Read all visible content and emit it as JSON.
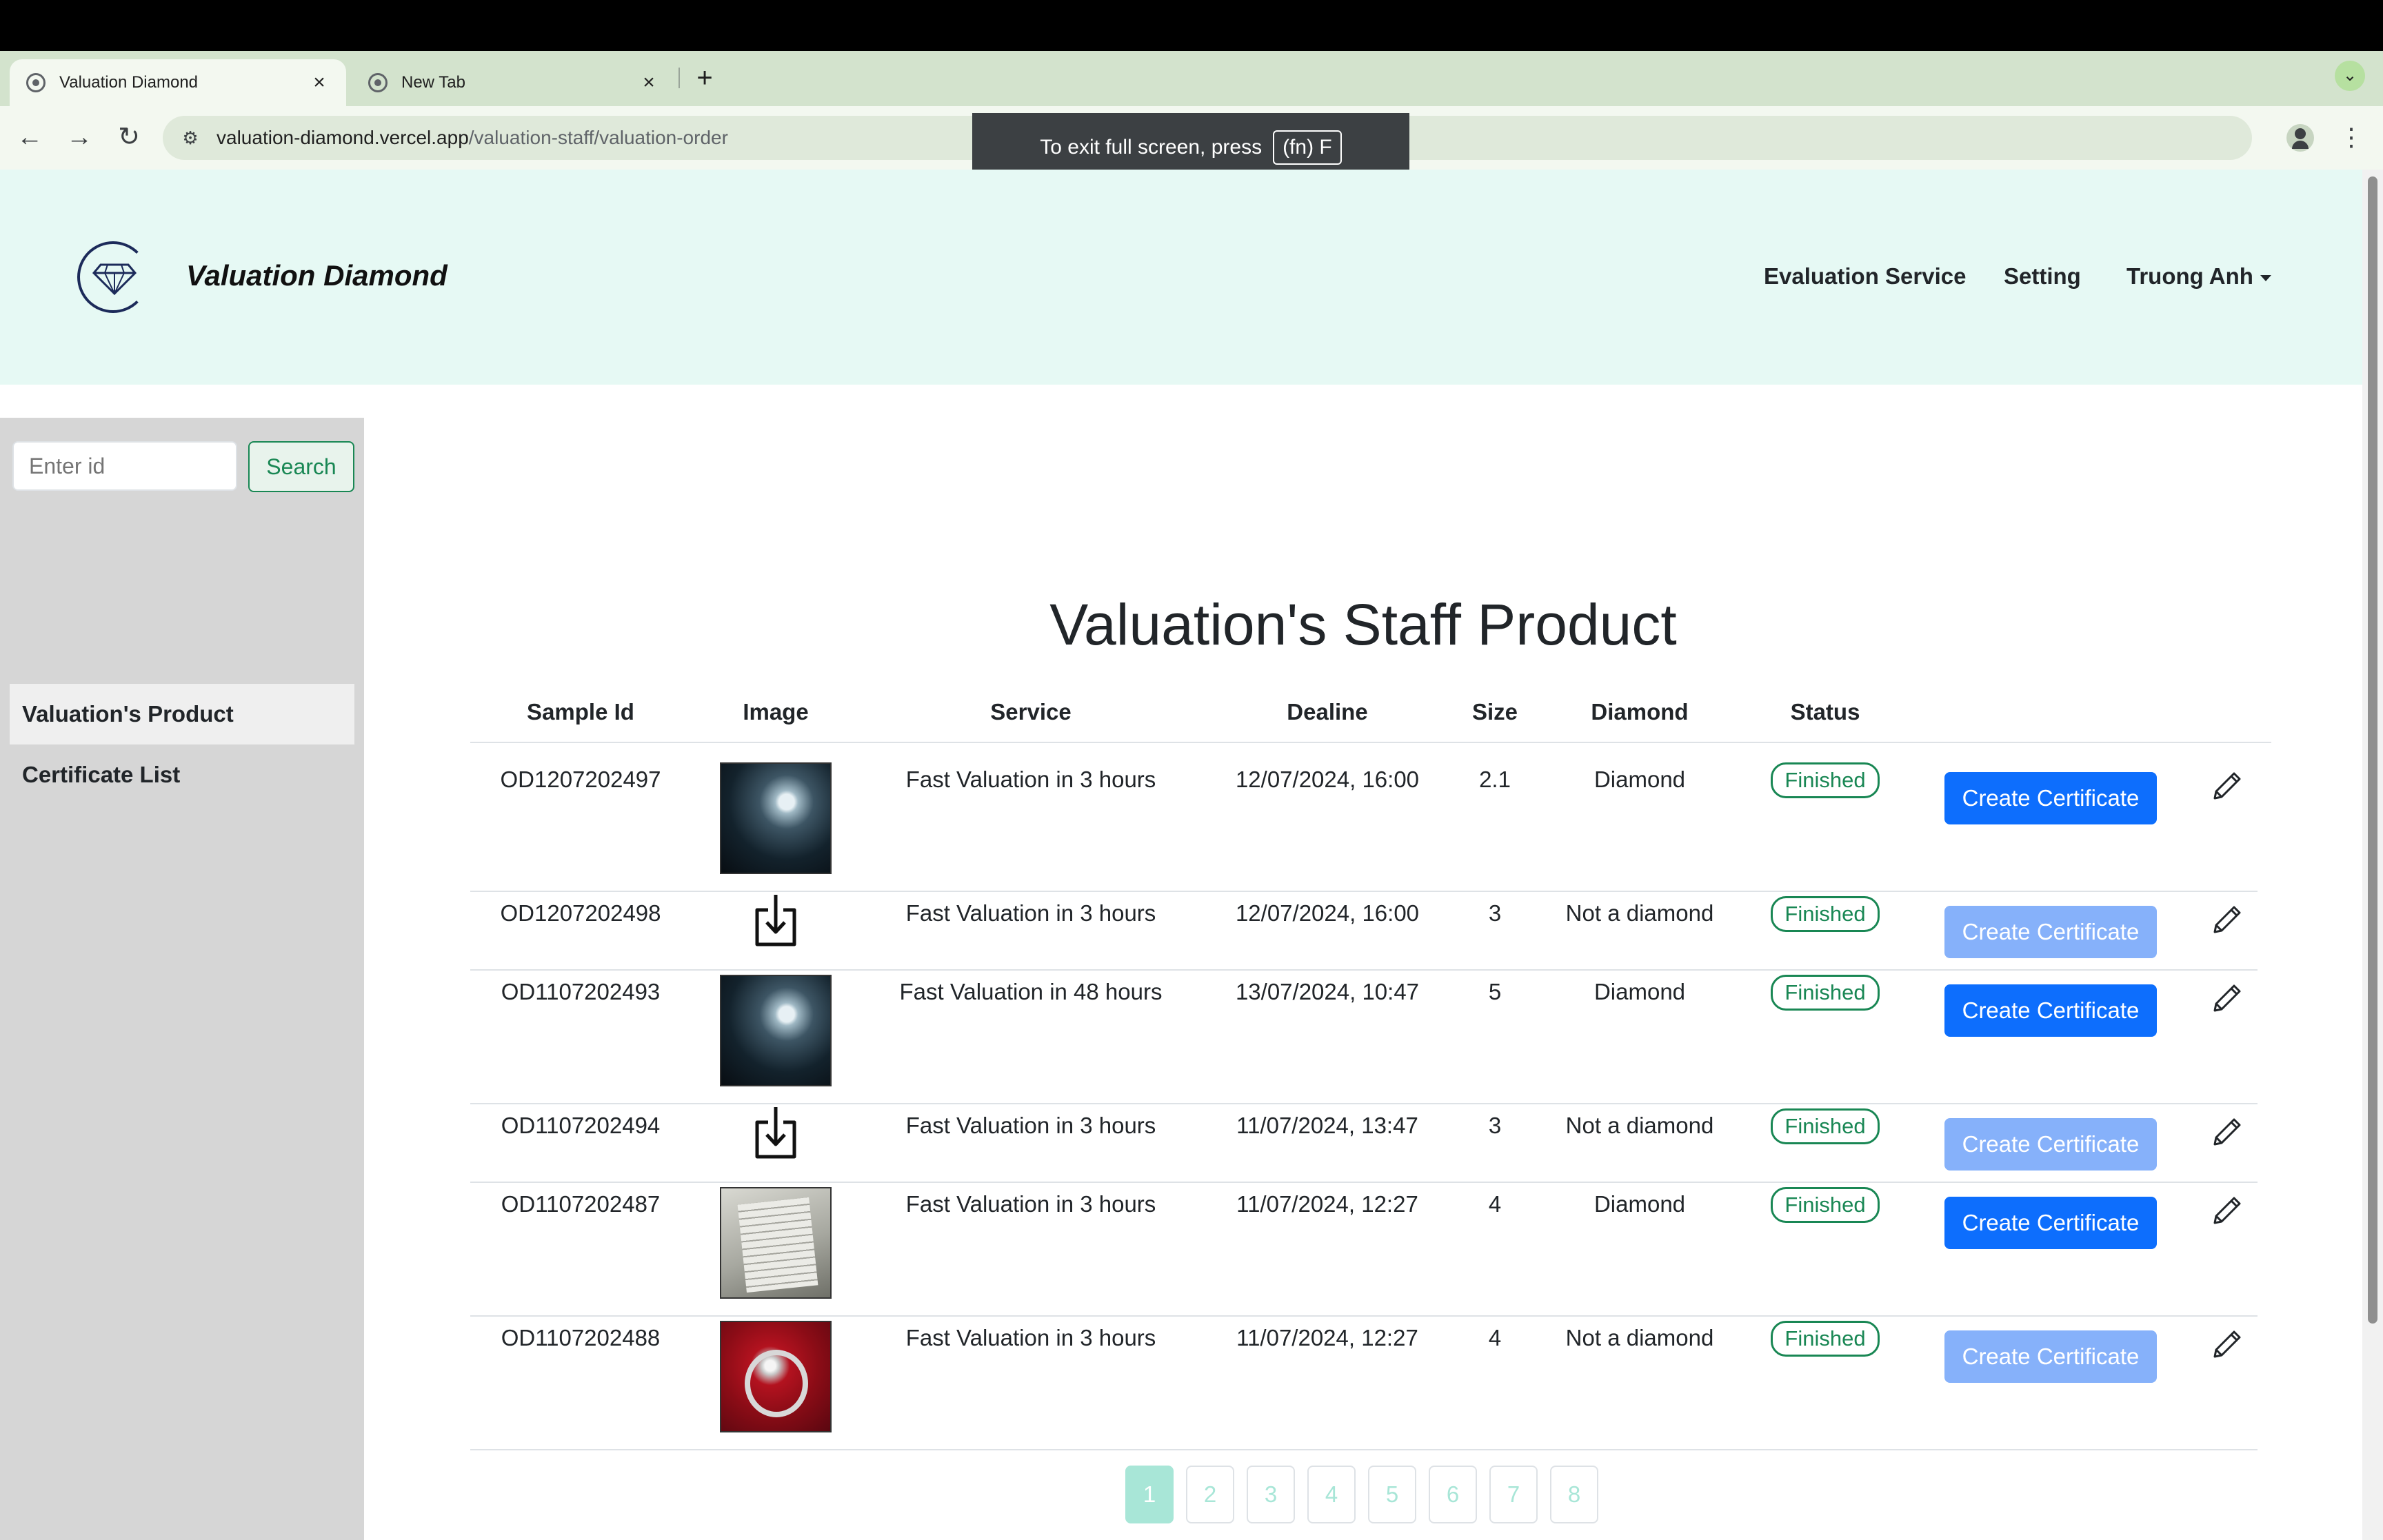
{
  "browser": {
    "tabs": [
      {
        "title": "Valuation Diamond",
        "close": "×"
      },
      {
        "title": "New Tab",
        "close": "×"
      }
    ],
    "new_tab": "+",
    "tab_list": "⌄",
    "url_host": "valuation-diamond.vercel.app",
    "url_path": "/valuation-staff/valuation-order",
    "nav": {
      "back": "←",
      "forward": "→",
      "reload": "↻",
      "site_info": "⚙",
      "star": "☆",
      "menu": "⋮"
    },
    "toast_text": "To exit full screen, press",
    "toast_key": "(fn) F"
  },
  "header": {
    "brand": "Valuation Diamond",
    "nav": [
      "Evaluation Service",
      "Setting",
      "Truong Anh"
    ]
  },
  "sidebar": {
    "search_placeholder": "Enter id",
    "search_button": "Search",
    "items": [
      "Valuation's Product",
      "Certificate List"
    ]
  },
  "main": {
    "title": "Valuation's Staff Product",
    "columns": [
      "Sample Id",
      "Image",
      "Service",
      "Dealine",
      "Size",
      "Diamond",
      "Status"
    ],
    "rows": [
      {
        "id": "OD1207202497",
        "image": "diamond-photo",
        "service": "Fast Valuation in 3 hours",
        "deadline": "12/07/2024, 16:00",
        "size": "2.1",
        "diamond": "Diamond",
        "status": "Finished",
        "action": "Create Certificate",
        "action_enabled": true
      },
      {
        "id": "OD1207202498",
        "image": "download-icon",
        "service": "Fast Valuation in 3 hours",
        "deadline": "12/07/2024, 16:00",
        "size": "3",
        "diamond": "Not a diamond",
        "status": "Finished",
        "action": "Create Certificate",
        "action_enabled": false
      },
      {
        "id": "OD1107202493",
        "image": "diamond-photo",
        "service": "Fast Valuation in 48 hours",
        "deadline": "13/07/2024, 10:47",
        "size": "5",
        "diamond": "Diamond",
        "status": "Finished",
        "action": "Create Certificate",
        "action_enabled": true
      },
      {
        "id": "OD1107202494",
        "image": "download-icon",
        "service": "Fast Valuation in 3 hours",
        "deadline": "11/07/2024, 13:47",
        "size": "3",
        "diamond": "Not a diamond",
        "status": "Finished",
        "action": "Create Certificate",
        "action_enabled": false
      },
      {
        "id": "OD1107202487",
        "image": "paper-photo",
        "service": "Fast Valuation in 3 hours",
        "deadline": "11/07/2024, 12:27",
        "size": "4",
        "diamond": "Diamond",
        "status": "Finished",
        "action": "Create Certificate",
        "action_enabled": true
      },
      {
        "id": "OD1107202488",
        "image": "ring-photo",
        "service": "Fast Valuation in 3 hours",
        "deadline": "11/07/2024, 12:27",
        "size": "4",
        "diamond": "Not a diamond",
        "status": "Finished",
        "action": "Create Certificate",
        "action_enabled": false
      }
    ],
    "pagination": {
      "pages": [
        "1",
        "2",
        "3",
        "4",
        "5",
        "6",
        "7",
        "8"
      ],
      "current": "1"
    }
  },
  "colors": {
    "primary": "#0d6efd",
    "primary_disabled": "#86b1fa",
    "success": "#198754",
    "header_bg": "#e6f9f4",
    "sidebar_bg": "#d6d6d6",
    "pager_accent": "#a8e6d7"
  }
}
